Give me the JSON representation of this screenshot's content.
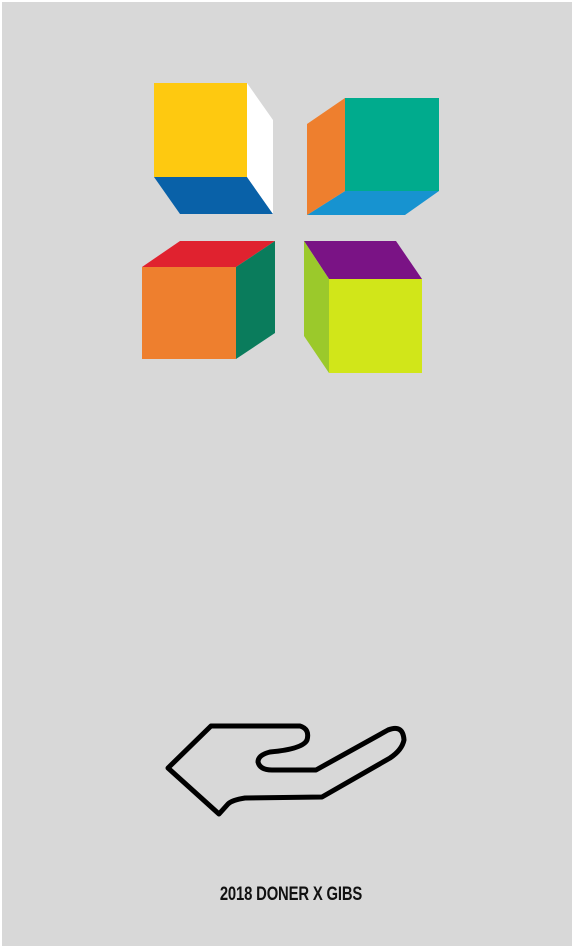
{
  "poster": {
    "caption": "2018 DONER X GIBS",
    "background_color": "#d8d8d8",
    "cubes": [
      {
        "name": "yellow-cube",
        "faces": {
          "front": "#fec910",
          "side": "#ffffff",
          "bottom": "#0961a8"
        }
      },
      {
        "name": "green-cube",
        "faces": {
          "front": "#00ab8d",
          "side": "#ee7f2e",
          "bottom": "#1793d0"
        }
      },
      {
        "name": "orange-cube",
        "faces": {
          "front": "#ee7f2e",
          "side": "#0a7c5c",
          "top": "#e0222f"
        }
      },
      {
        "name": "lime-cube",
        "faces": {
          "front": "#d1e619",
          "side": "#9bc92b",
          "top": "#7a1385"
        }
      }
    ],
    "icon": "open-hand-icon"
  }
}
